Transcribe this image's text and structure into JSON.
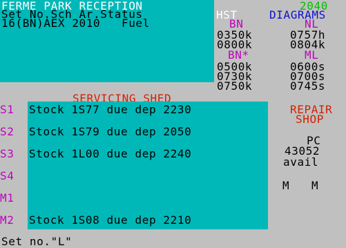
{
  "header": {
    "title": "FERME PARK RECEPTION",
    "year": "2040",
    "columns": "Set No.Sch Ar.Status",
    "set_row": "16(BN)AEX 2010   Fuel"
  },
  "diagrams": {
    "title_left": "HST",
    "title_right": "DIAGRAMS",
    "bn_label": "BN",
    "nl_label": "NL",
    "bn_times": [
      "0350k",
      "0800k"
    ],
    "nl_times": [
      "0757h",
      "0804k"
    ],
    "bnstar_label": "BN*",
    "ml_label": "ML",
    "bnstar_times": [
      "0500k",
      "0730k",
      "0750k"
    ],
    "ml_times": [
      "0600s",
      "0700s",
      "0745s"
    ]
  },
  "shed": {
    "title": "SERVICING SHED",
    "slots": [
      {
        "id": "S1",
        "text": "Stock 1S77 due dep 2230"
      },
      {
        "id": "S2",
        "text": "Stock 1S79 due dep 2050"
      },
      {
        "id": "S3",
        "text": "Stock 1L00 due dep 2240"
      },
      {
        "id": "S4",
        "text": ""
      },
      {
        "id": "M1",
        "text": ""
      },
      {
        "id": "M2",
        "text": "Stock 1S08 due dep 2210"
      }
    ]
  },
  "repair": {
    "title_1": "REPAIR",
    "title_2": "SHOP",
    "pc_label": "PC",
    "loco": "43052",
    "status": "avail",
    "m_left": "M",
    "m_right": "M"
  },
  "prompt": "Set no.\"L\"",
  "colors": {
    "background": "#c0c0c0",
    "panel": "#00b8b8",
    "text_white": "#ffffff",
    "label_magenta": "#c000c0",
    "title_red": "#d42000",
    "year_green": "#00c000",
    "heading_blue": "#1010d0"
  }
}
